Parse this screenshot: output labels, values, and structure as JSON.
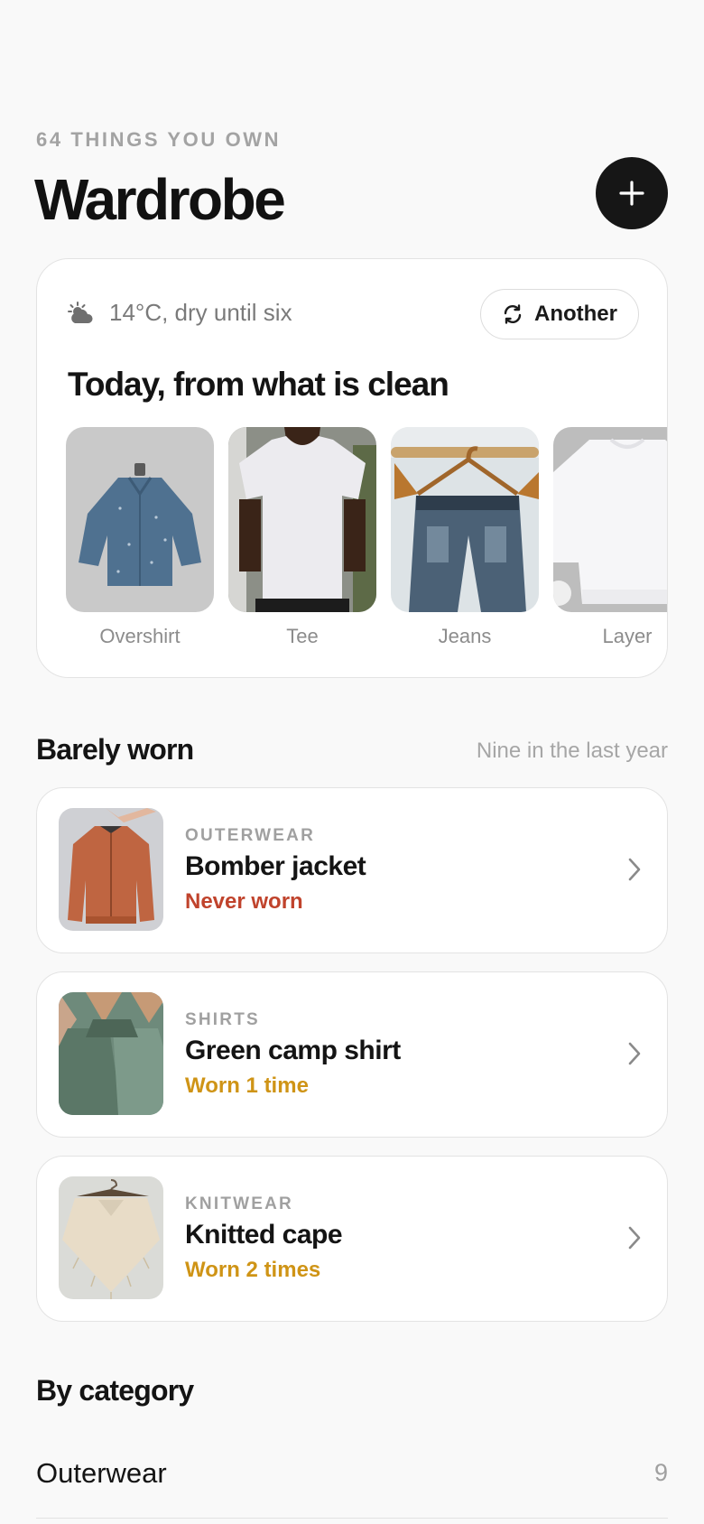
{
  "header": {
    "eyebrow": "64 THINGS YOU OWN",
    "title": "Wardrobe",
    "add_icon": "plus-icon"
  },
  "outfit": {
    "weather_icon": "sun-behind-cloud-icon",
    "weather": "14°C, dry until six",
    "another_label": "Another",
    "another_icon": "refresh-icon",
    "heading": "Today, from what is clean",
    "items": [
      {
        "label": "Overshirt"
      },
      {
        "label": "Tee"
      },
      {
        "label": "Jeans"
      },
      {
        "label": "Layer"
      }
    ]
  },
  "barely_worn": {
    "title": "Barely worn",
    "note": "Nine in the last year",
    "items": [
      {
        "category": "OUTERWEAR",
        "name": "Bomber jacket",
        "status": "Never worn",
        "status_color": "#c0432c"
      },
      {
        "category": "SHIRTS",
        "name": "Green camp shirt",
        "status": "Worn 1 time",
        "status_color": "#cf9416"
      },
      {
        "category": "KNITWEAR",
        "name": "Knitted cape",
        "status": "Worn 2 times",
        "status_color": "#cf9416"
      }
    ]
  },
  "by_category": {
    "title": "By category",
    "rows": [
      {
        "name": "Outerwear",
        "count": "9"
      }
    ]
  },
  "colors": {
    "accent_dark": "#161616",
    "never_worn": "#c0432c",
    "rarely_worn": "#cf9416"
  }
}
